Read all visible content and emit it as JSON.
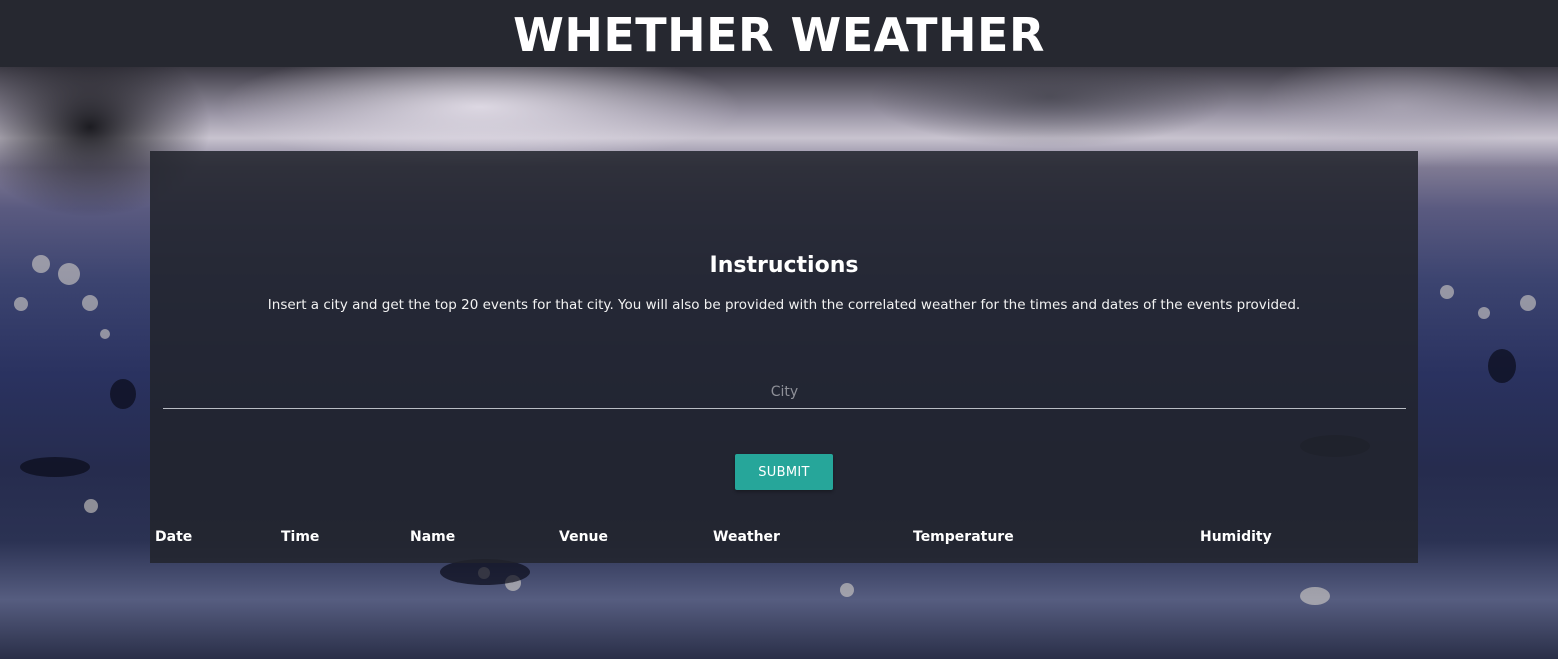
{
  "header": {
    "title": "WHETHER WEATHER"
  },
  "main": {
    "instructions_title": "Instructions",
    "instructions_text": "Insert a city and get the top 20 events for that city. You will also be provided with the correlated weather for the times and dates of the events provided.",
    "city_input": {
      "placeholder": "City",
      "value": ""
    },
    "submit_label": "SUBMIT",
    "results_table": {
      "columns": [
        "Date",
        "Time",
        "Name",
        "Venue",
        "Weather",
        "Temperature",
        "Humidity"
      ],
      "rows": []
    }
  },
  "colors": {
    "header_bg": "#262830",
    "card_bg": "#22242c",
    "accent": "#26a69a"
  }
}
